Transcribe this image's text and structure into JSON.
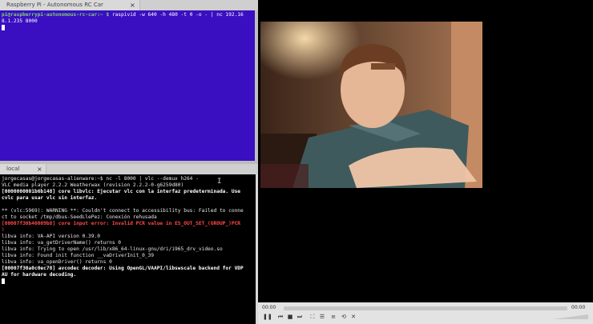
{
  "top_terminal": {
    "tab_title": "Raspberry Pi - Autonomous RC Car",
    "close_glyph": "×",
    "lines": [
      {
        "prompt": "pi@raspberrypi-autonomous-rc-car:~ $ ",
        "cmd": "raspivid -w 640 -h 480 -t 0 -o - | nc 192.16"
      },
      {
        "prompt": "",
        "cmd": "8.1.235 8000"
      }
    ]
  },
  "bottom_terminal": {
    "tab_title": "local",
    "close_glyph": "×",
    "lines": [
      "jorgecasas@jorgecasas-alienware:~$ nc -l 8000 | vlc --demux h264 -",
      "VLC media player 2.2.2 Weatherwax (revision 2.2.2-0-g6259d80)",
      "[0000000001b6b148] core libvlc: Ejecutar vlc con la interfaz predeterminada. Use",
      "cvlc para usar vlc sin interfaz.",
      "",
      "** (vlc:5969): WARNING **: Couldn't connect to accessibility bus: Failed to conne",
      "ct to socket /tmp/dbus-SeedLlePez: Conexión rehusada",
      "[00007f30b40009b8] core input error: Invalid PCR value in ES_OUT_SET_(GROUP_)PCR",
      "!",
      "libva info: VA-API version 0.39.0",
      "libva info: va_getDriverName() returns 0",
      "libva info: Trying to open /usr/lib/x86_64-linux-gnu/dri/i965_drv_video.so",
      "libva info: Found init function __vaDriverInit_0_39",
      "libva info: va_openDriver() returns 0",
      "[00007f30a0c0ec78] avcodec decoder: Using OpenGL/VAAPI/libswscale backend for VDP",
      "AU for hardware decoding."
    ]
  },
  "vlc": {
    "elapsed": "00:00",
    "total": "00:00",
    "progress": 0,
    "controls": [
      "pause-icon",
      "previous-icon",
      "stop-icon",
      "next-icon",
      "fullscreen-icon",
      "extended-settings-icon",
      "playlist-icon",
      "loop-icon",
      "shuffle-icon"
    ],
    "volume_level": 0
  }
}
